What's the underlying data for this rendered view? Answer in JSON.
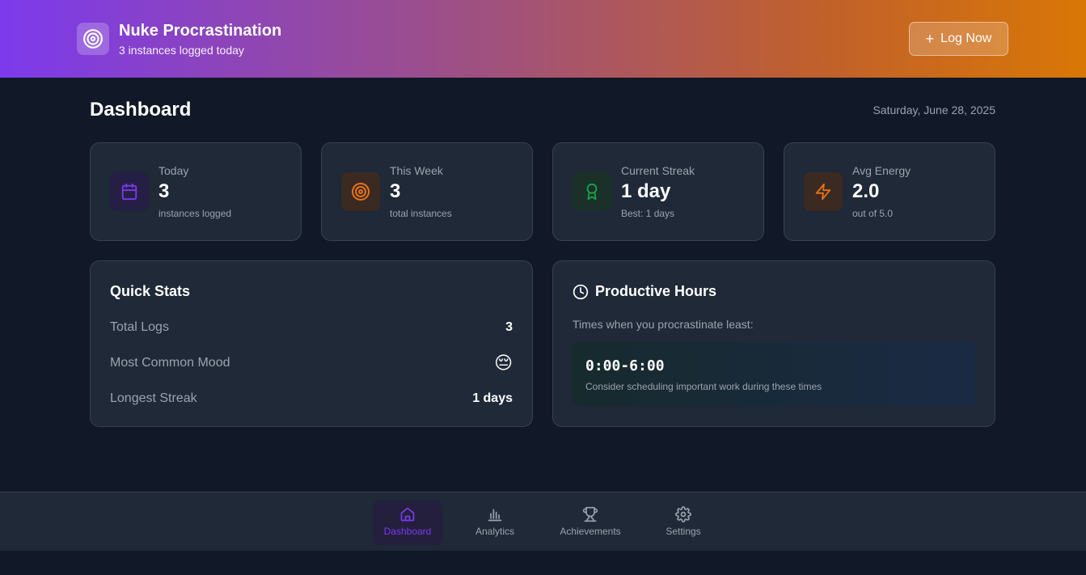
{
  "header": {
    "title": "Nuke Procrastination",
    "subtitle": "3 instances logged today",
    "log_button": "Log Now",
    "logo_icon": "target-icon"
  },
  "page": {
    "title": "Dashboard",
    "date": "Saturday, June 28, 2025"
  },
  "stats": [
    {
      "label": "Today",
      "value": "3",
      "sub": "instances logged",
      "icon": "calendar-icon",
      "color": "#7c3aed"
    },
    {
      "label": "This Week",
      "value": "3",
      "sub": "total instances",
      "icon": "target-icon",
      "color": "#ea7317"
    },
    {
      "label": "Current Streak",
      "value": "1 day",
      "sub": "Best: 1 days",
      "icon": "award-icon",
      "color": "#16a34a"
    },
    {
      "label": "Avg Energy",
      "value": "2.0",
      "sub": "out of 5.0",
      "icon": "lightning-icon",
      "color": "#ea7317"
    }
  ],
  "quick_stats": {
    "title": "Quick Stats",
    "rows": [
      {
        "label": "Total Logs",
        "value": "3"
      },
      {
        "label": "Most Common Mood",
        "value": "😔"
      },
      {
        "label": "Longest Streak",
        "value": "1 days"
      }
    ]
  },
  "productive_hours": {
    "title": "Productive Hours",
    "description": "Times when you procrastinate least:",
    "range": "0:00-6:00",
    "hint": "Consider scheduling important work during these times"
  },
  "nav": [
    {
      "label": "Dashboard",
      "icon": "home-icon",
      "active": true
    },
    {
      "label": "Analytics",
      "icon": "bar-chart-icon",
      "active": false
    },
    {
      "label": "Achievements",
      "icon": "trophy-icon",
      "active": false
    },
    {
      "label": "Settings",
      "icon": "gear-icon",
      "active": false
    }
  ],
  "colors": {
    "accent": "#7c3aed",
    "background": "#111827",
    "card": "#1f2937"
  }
}
